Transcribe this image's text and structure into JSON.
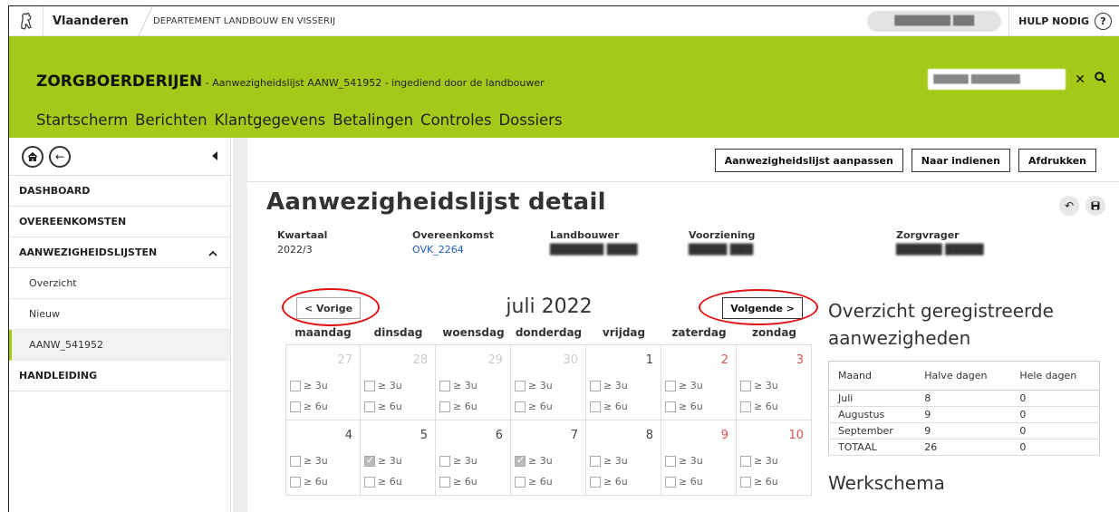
{
  "topbar": {
    "brand": "Vlaanderen",
    "department": "DEPARTEMENT LANDBOUW EN VISSERIJ",
    "user": "████████ ███",
    "help": "HULP NODIG",
    "help_icon": "?"
  },
  "header": {
    "title": "ZORGBOERDERIJEN",
    "subtitle": " - Aanwezigheidslijst AANW_541952 - ingediend door de landbouwer",
    "search_value": "█████ ███████",
    "nav": [
      "Startscherm",
      "Berichten",
      "Klantgegevens",
      "Betalingen",
      "Controles",
      "Dossiers"
    ]
  },
  "sidebar": {
    "items": [
      {
        "label": "DASHBOARD"
      },
      {
        "label": "OVEREENKOMSTEN"
      },
      {
        "label": "AANWEZIGHEIDSLIJSTEN"
      }
    ],
    "subitems": [
      {
        "label": "Overzicht"
      },
      {
        "label": "Nieuw"
      },
      {
        "label": "AANW_541952"
      }
    ],
    "footer_item": "HANDLEIDING"
  },
  "toolbar": {
    "adjust": "Aanwezigheidslijst aanpassen",
    "submit": "Naar indienen",
    "print": "Afdrukken"
  },
  "page": {
    "title": "Aanwezigheidslijst detail"
  },
  "meta": {
    "kwartaal_label": "Kwartaal",
    "kwartaal": "2022/3",
    "overeenkomst_label": "Overeenkomst",
    "overeenkomst": "OVK_2264",
    "landbouwer_label": "Landbouwer",
    "landbouwer": "███████ ████",
    "voorziening_label": "Voorziening",
    "voorziening": "█████ ███",
    "zorgvrager_label": "Zorgvrager",
    "zorgvrager": "██████ █████"
  },
  "calendar": {
    "prev": "< Vorige",
    "next": "Volgende >",
    "month": "juli 2022",
    "weekdays": [
      "maandag",
      "dinsdag",
      "woensdag",
      "donderdag",
      "vrijdag",
      "zaterdag",
      "zondag"
    ],
    "opt1": "≥ 3u",
    "opt2": "≥ 6u",
    "days": [
      {
        "n": "27",
        "muted": true
      },
      {
        "n": "28",
        "muted": true
      },
      {
        "n": "29",
        "muted": true
      },
      {
        "n": "30",
        "muted": true
      },
      {
        "n": "1"
      },
      {
        "n": "2",
        "weekend": true
      },
      {
        "n": "3",
        "weekend": true
      },
      {
        "n": "4"
      },
      {
        "n": "5",
        "checked": true
      },
      {
        "n": "6"
      },
      {
        "n": "7",
        "checked": true
      },
      {
        "n": "8"
      },
      {
        "n": "9",
        "weekend": true
      },
      {
        "n": "10",
        "weekend": true
      }
    ]
  },
  "overview": {
    "title": "Overzicht geregistreerde aanwezigheden",
    "headers": [
      "Maand",
      "Halve dagen",
      "Hele dagen"
    ],
    "rows": [
      [
        "Juli",
        "8",
        "0"
      ],
      [
        "Augustus",
        "9",
        "0"
      ],
      [
        "September",
        "9",
        "0"
      ],
      [
        "TOTAAL",
        "26",
        "0"
      ]
    ],
    "schedule_title": "Werkschema"
  }
}
